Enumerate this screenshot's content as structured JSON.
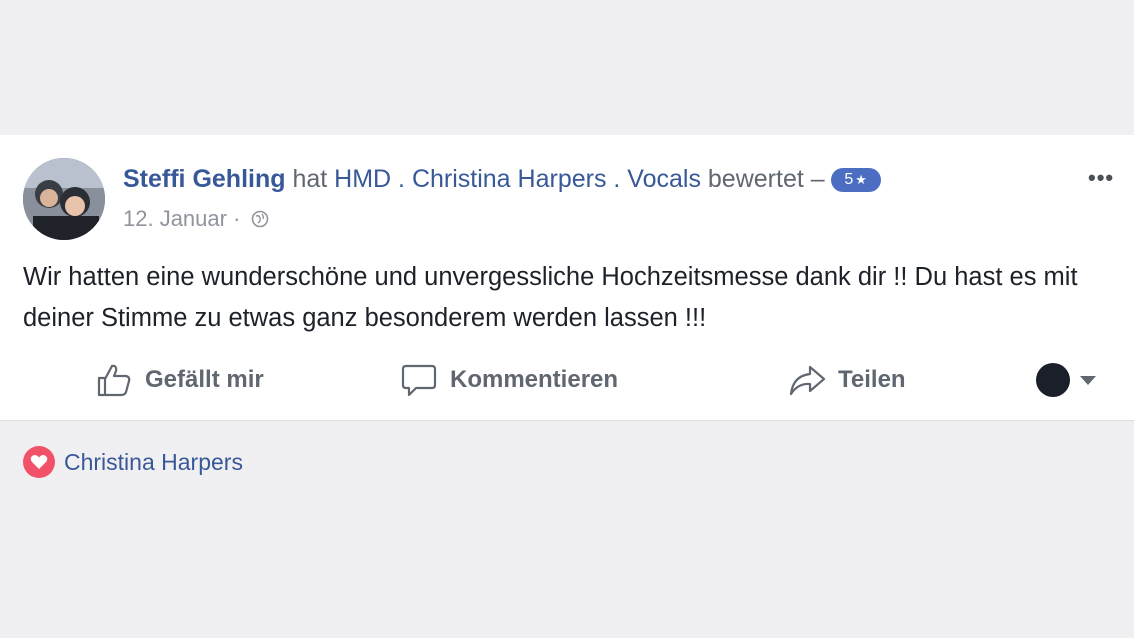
{
  "post": {
    "author": "Steffi Gehling",
    "verb": "hat",
    "page": "HMD . Christina Harpers . Vocals",
    "action": "bewertet –",
    "rating": "5",
    "date": "12. Januar",
    "separator": "·",
    "more_label": "•••",
    "text": "Wir hatten eine wunderschöne und unvergessliche Hochzeitsmesse dank dir !! Du hast es mit deiner Stimme zu etwas ganz besonderem werden lassen !!!"
  },
  "actions": {
    "like": "Gefällt mir",
    "comment": "Kommentieren",
    "share": "Teilen"
  },
  "reactions": {
    "names": "Christina Harpers",
    "type": "heart-icon"
  },
  "colors": {
    "link": "#385898",
    "badge": "#4b6ec2",
    "heart": "#f25268",
    "background": "#f0f0f2"
  }
}
